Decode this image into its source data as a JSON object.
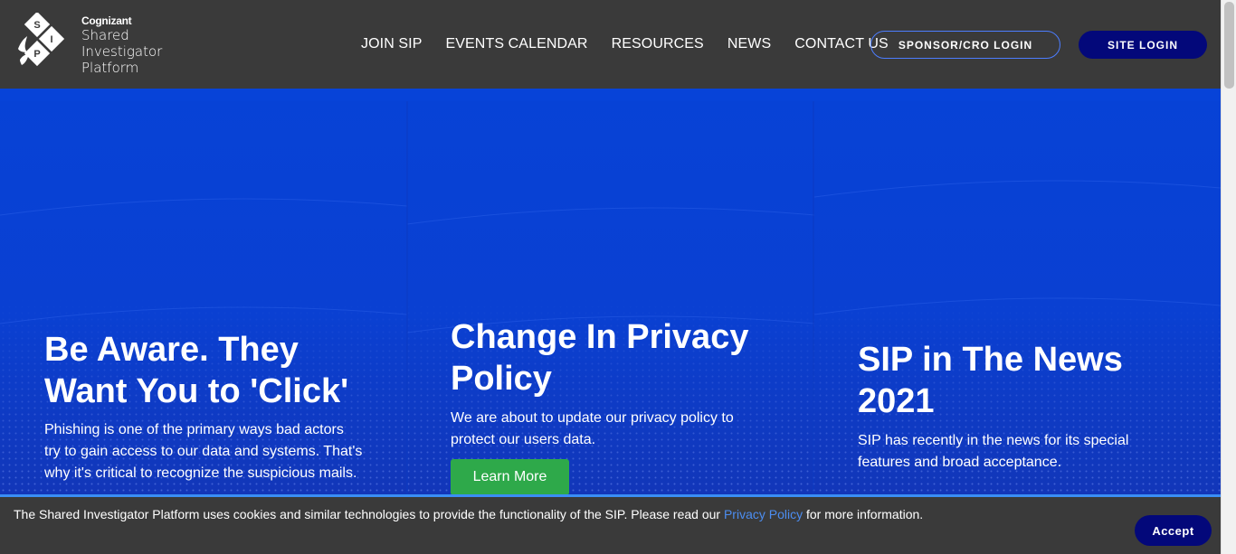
{
  "logo": {
    "brand": "Cognizant",
    "lines": [
      "Shared",
      "Investigator",
      "Platform"
    ],
    "mark_letters": [
      "S",
      "I",
      "P"
    ]
  },
  "nav": {
    "items": [
      "JOIN SIP",
      "EVENTS CALENDAR",
      "RESOURCES",
      "NEWS",
      "CONTACT US"
    ],
    "sponsor_login": "SPONSOR/CRO LOGIN",
    "site_login": "SITE LOGIN"
  },
  "hero": {
    "panels": [
      {
        "title_lines": [
          "Be Aware. They",
          "Want You to 'Click'"
        ],
        "desc_lines": [
          "Phishing is one of the primary ways bad actors",
          "try to gain access to our data and systems. That's",
          "why it's critical to recognize the suspicious mails."
        ]
      },
      {
        "title_lines": [
          "Change In Privacy",
          "Policy"
        ],
        "desc_lines": [
          "We are about to update our privacy policy to",
          "protect our users data."
        ],
        "button": "Learn More"
      },
      {
        "title_lines": [
          "SIP in The News",
          "2021"
        ],
        "desc_lines": [
          "SIP has recently in the news for its special",
          "features and broad acceptance."
        ]
      }
    ]
  },
  "cookie": {
    "text_before": "The Shared Investigator Platform uses cookies and similar technologies to provide the functionality of the SIP. Please read our ",
    "link": "Privacy Policy",
    "text_after": " for more information.",
    "accept": "Accept"
  },
  "colors": {
    "header_bg": "#3a3a3a",
    "hero_blue": "#0a3fd0",
    "dark_navy": "#03087a",
    "green": "#2ea94a",
    "link_blue": "#4c8df0"
  }
}
